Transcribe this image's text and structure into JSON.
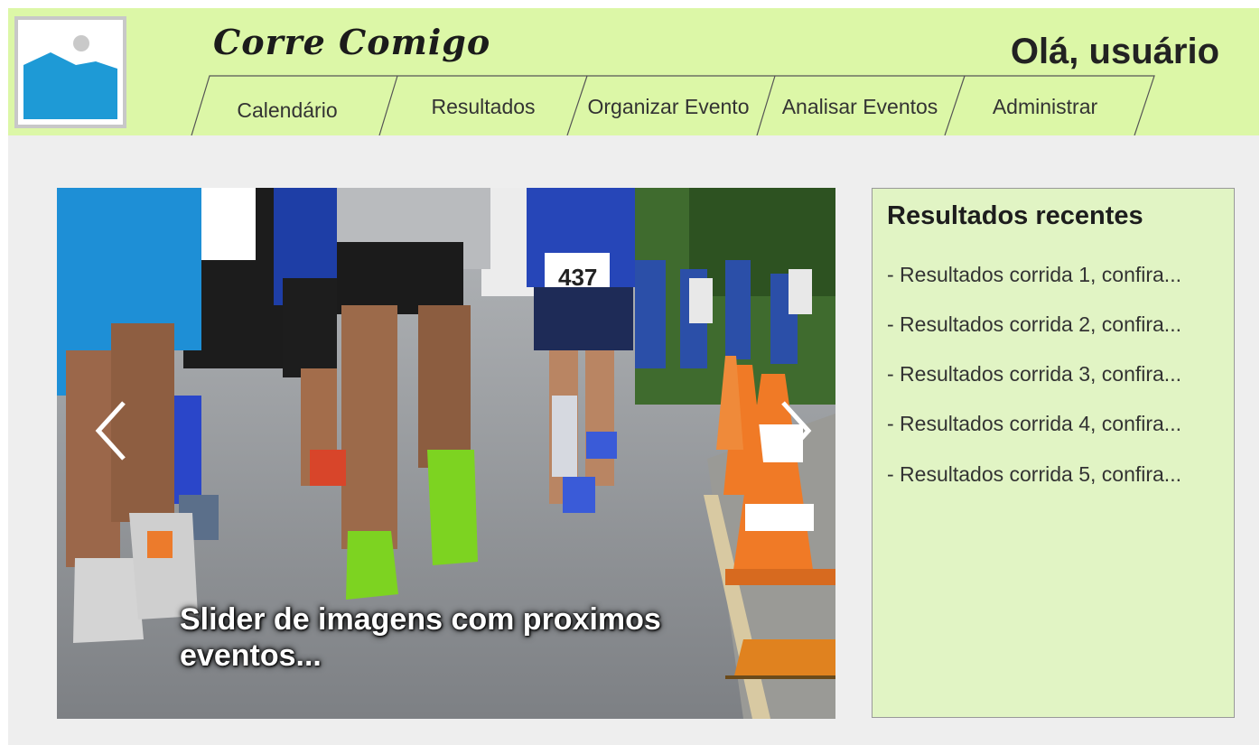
{
  "header": {
    "logo_icon": "image-placeholder-icon",
    "brand": "Corre Comigo",
    "greeting": "Olá, usuário",
    "background": "#dcf7a7"
  },
  "nav": {
    "items": [
      {
        "label": "Calendário"
      },
      {
        "label": "Resultados"
      },
      {
        "label": "Organizar Evento"
      },
      {
        "label": "Analisar Eventos"
      },
      {
        "label": "Administrar"
      }
    ]
  },
  "slider": {
    "caption": "Slider de imagens com proximos eventos...",
    "prev_icon": "chevron-left-icon",
    "next_icon": "chevron-right-icon",
    "bib_number": "437"
  },
  "recent_results": {
    "title": "Resultados recentes",
    "background": "#e1f4c4",
    "items": [
      {
        "text": "- Resultados corrida 1, confira..."
      },
      {
        "text": "- Resultados corrida 2, confira..."
      },
      {
        "text": "- Resultados corrida 3, confira..."
      },
      {
        "text": "- Resultados corrida 4, confira..."
      },
      {
        "text": "- Resultados corrida 5, confira..."
      }
    ]
  }
}
